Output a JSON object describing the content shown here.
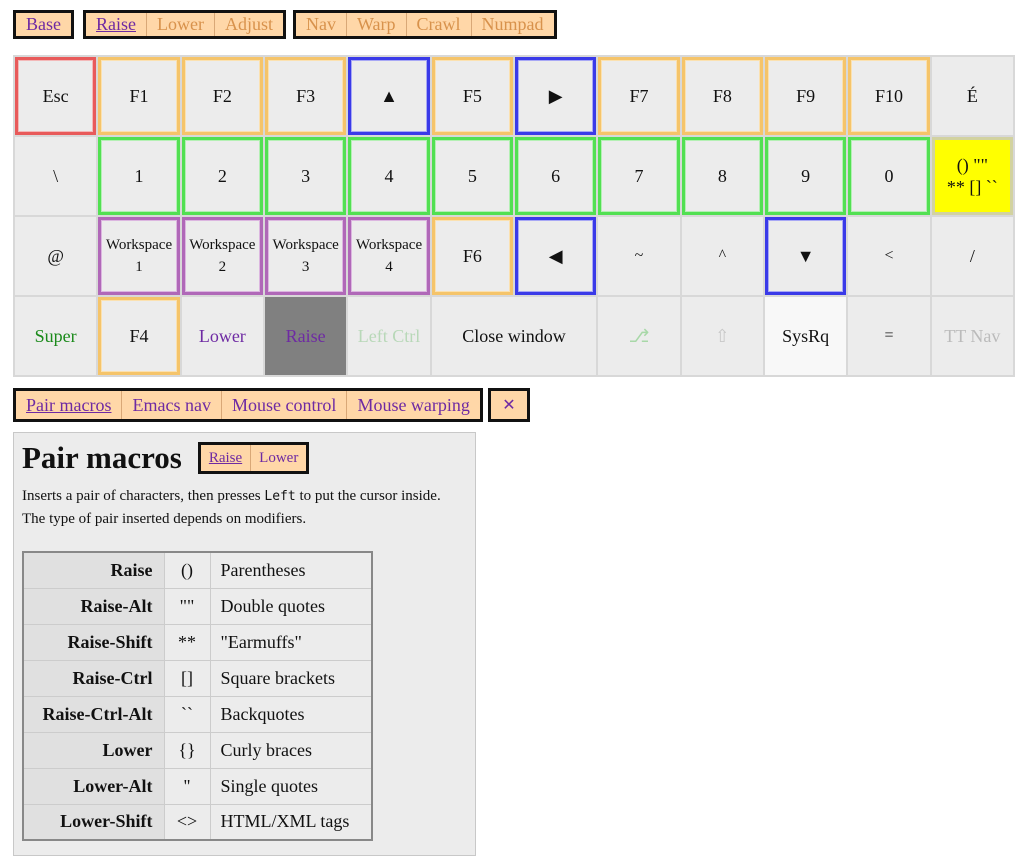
{
  "layer_tabs": {
    "group1": [
      {
        "label": "Base",
        "active": false
      }
    ],
    "group2": [
      {
        "label": "Raise",
        "active": true
      },
      {
        "label": "Lower",
        "active": false
      },
      {
        "label": "Adjust",
        "active": false
      }
    ],
    "group3": [
      {
        "label": "Nav",
        "active": false
      },
      {
        "label": "Warp",
        "active": false
      },
      {
        "label": "Crawl",
        "active": false
      },
      {
        "label": "Numpad",
        "active": false
      }
    ]
  },
  "keyboard": {
    "row0": [
      "Esc",
      "F1",
      "F2",
      "F3",
      "▲",
      "F5",
      "▶",
      "F7",
      "F8",
      "F9",
      "F10",
      "É"
    ],
    "row1": [
      "\\",
      "1",
      "2",
      "3",
      "4",
      "5",
      "6",
      "7",
      "8",
      "9",
      "0"
    ],
    "pair_key": {
      "line1": "() \"\"",
      "line2": "** [] ``"
    },
    "row2": [
      "@",
      "Workspace",
      "Workspace",
      "Workspace",
      "Workspace",
      "F6",
      "◀",
      "~",
      "^",
      "▼",
      "<",
      "/"
    ],
    "workspace_numbers": [
      "1",
      "2",
      "3",
      "4"
    ],
    "row3": {
      "super": "Super",
      "f4": "F4",
      "lower": "Lower",
      "raise": "Raise",
      "left_ctrl": "Left Ctrl",
      "close_window": "Close window",
      "tab_arrow": "⎇",
      "shift_arrow": "⇧",
      "sysrq": "SysRq",
      "equals": "=",
      "tt_nav": "TT Nav"
    }
  },
  "macro_tabs": [
    {
      "label": "Pair macros",
      "active": true
    },
    {
      "label": "Emacs nav",
      "active": false
    },
    {
      "label": "Mouse control",
      "active": false
    },
    {
      "label": "Mouse warping",
      "active": false
    }
  ],
  "close_label": "✕",
  "legend": {
    "title": "Pair macros",
    "layer_tabs": [
      {
        "label": "Raise",
        "active": true
      },
      {
        "label": "Lower",
        "active": false
      }
    ],
    "desc_before": "Inserts a pair of characters, then presses",
    "desc_code": "Left",
    "desc_after": "to put the cursor inside.",
    "desc_line2": "The type of pair inserted depends on modifiers.",
    "rows": [
      {
        "mod": "Raise",
        "sym": "()",
        "desc": "Parentheses"
      },
      {
        "mod": "Raise-Alt",
        "sym": "\"\"",
        "desc": "Double quotes"
      },
      {
        "mod": "Raise-Shift",
        "sym": "**",
        "desc": "\"Earmuffs\""
      },
      {
        "mod": "Raise-Ctrl",
        "sym": "[]",
        "desc": "Square brackets"
      },
      {
        "mod": "Raise-Ctrl-Alt",
        "sym": "``",
        "desc": "Backquotes"
      },
      {
        "mod": "Lower",
        "sym": "{}",
        "desc": "Curly braces"
      },
      {
        "mod": "Lower-Alt",
        "sym": "''",
        "desc": "Single quotes"
      },
      {
        "mod": "Lower-Shift",
        "sym": "<>",
        "desc": "HTML/XML tags"
      }
    ]
  },
  "colors": {
    "tab_bg": "#ffd7a8",
    "tab_inactive": "#d8924c",
    "tab_active": "#6e2aa3",
    "key_bg": "#ececec",
    "esc_border": "#e85a5a",
    "fkey_border": "#f5c46a",
    "arrow_border": "#3a3ae8",
    "digit_border": "#52e052",
    "workspace_border": "#b068b8",
    "pair_key_bg": "#ffff00",
    "super_text": "#1a8a1a",
    "lower_text": "#6e2aa3",
    "raise_key_bg": "#808080",
    "disabled_text": "#bbbbbb"
  }
}
